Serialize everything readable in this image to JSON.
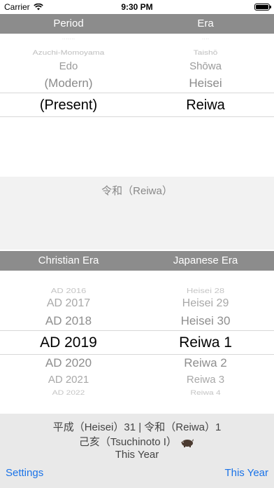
{
  "status": {
    "carrier": "Carrier",
    "time": "9:30 PM"
  },
  "top_header": {
    "left": "Period",
    "right": "Era"
  },
  "top_picker": {
    "periods": [
      "Azuchi-Momoyama",
      "Edo",
      "(Modern)",
      "(Present)"
    ],
    "eras": [
      "Taishō",
      "Shōwa",
      "Heisei",
      "Reiwa"
    ]
  },
  "reiwa_label": "令和（Reiwa）",
  "bottom_header": {
    "left": "Christian Era",
    "right": "Japanese Era"
  },
  "bottom_picker": {
    "christian": [
      "AD 2016",
      "AD 2017",
      "AD 2018",
      "AD 2019",
      "AD 2020",
      "AD 2021",
      "AD 2022"
    ],
    "japanese": [
      "Heisei 28",
      "Heisei 29",
      "Heisei 30",
      "Reiwa 1",
      "Reiwa 2",
      "Reiwa 3",
      "Reiwa 4"
    ]
  },
  "footer": {
    "line1": "平成（Heisei）31 | 令和（Reiwa）1",
    "line2": "己亥（Tsuchinoto I）",
    "line2_icon": "boar-icon",
    "line3": "This Year",
    "settings_label": "Settings",
    "this_year_label": "This Year"
  },
  "colors": {
    "header_bg": "#8c8c8c",
    "link": "#1a73e8"
  }
}
